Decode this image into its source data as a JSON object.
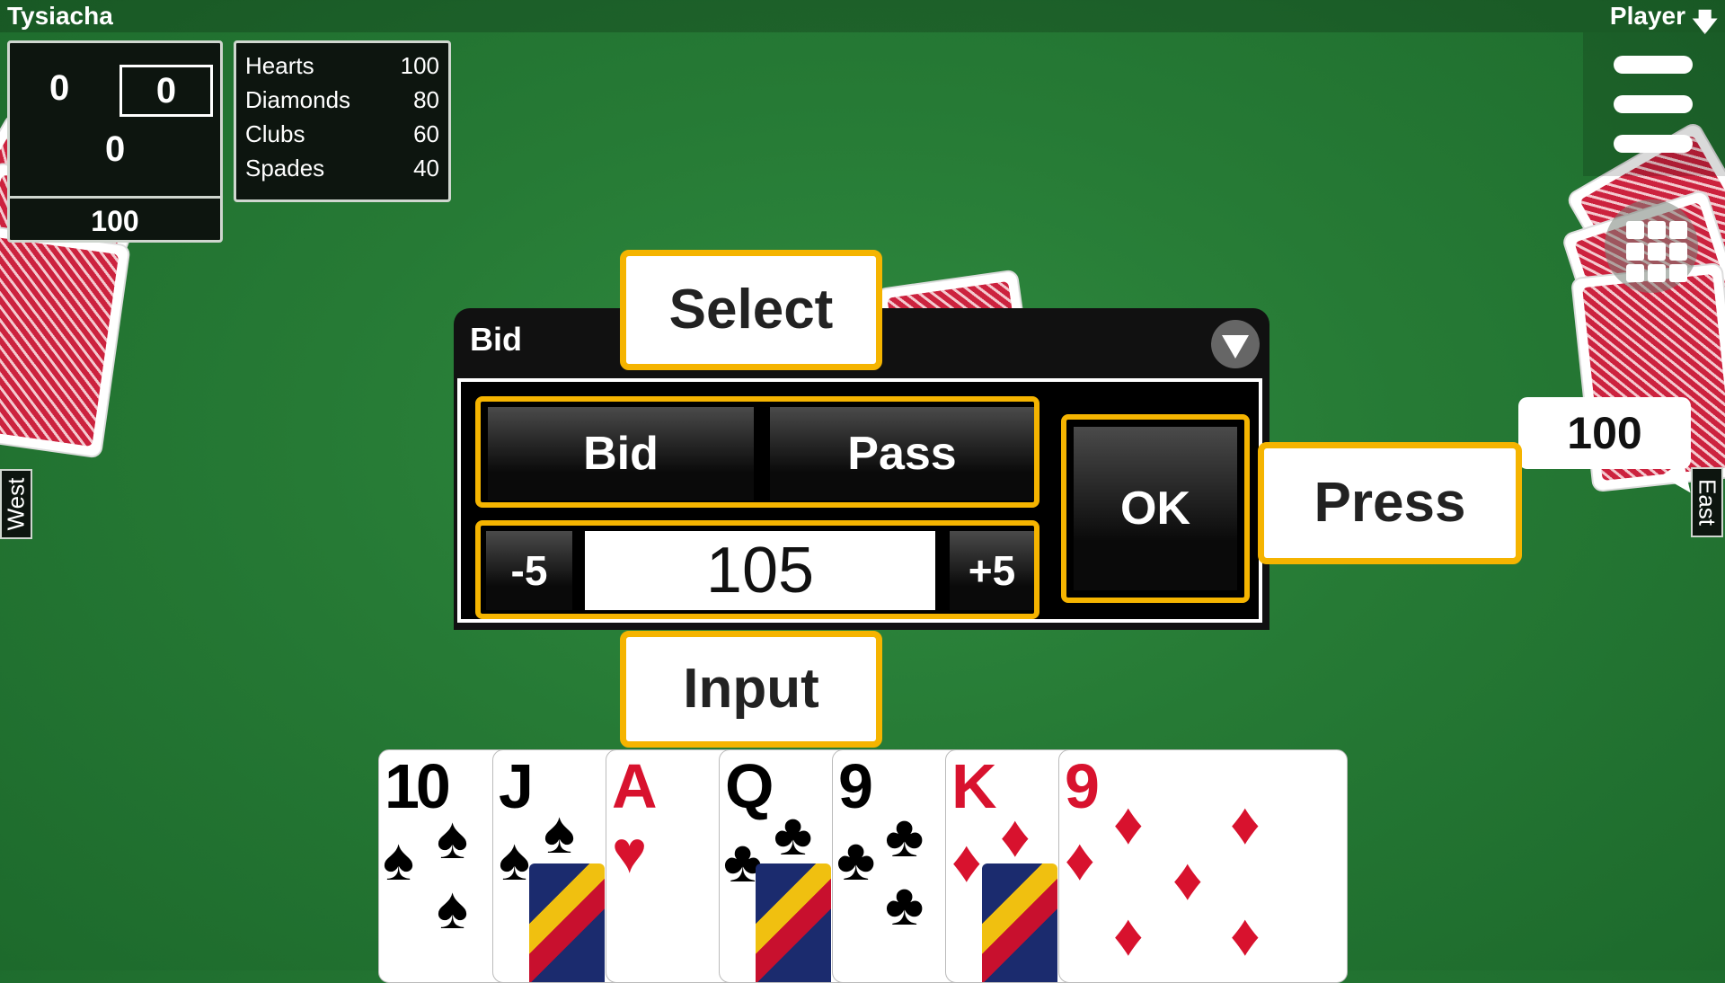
{
  "header": {
    "app_title": "Tysiacha",
    "player_label": "Player",
    "player_arrow": "🡇"
  },
  "scoreboard": {
    "score_a": "0",
    "score_b": "0",
    "score_c": "0",
    "current_bid": "100"
  },
  "suit_values": [
    {
      "suit": "Hearts",
      "value": "100"
    },
    {
      "suit": "Diamonds",
      "value": "80"
    },
    {
      "suit": "Clubs",
      "value": "60"
    },
    {
      "suit": "Spades",
      "value": "40"
    }
  ],
  "seats": {
    "west": "West",
    "east": "East"
  },
  "east_bubble": "100",
  "dialog": {
    "title": "Bid",
    "seg_bid": "Bid",
    "seg_pass": "Pass",
    "minus": "-5",
    "bid_value": "105",
    "plus": "+5",
    "ok": "OK"
  },
  "callouts": {
    "select": "Select",
    "input": "Input",
    "press": "Press"
  },
  "hand": [
    {
      "rank": "10",
      "suit": "♠",
      "color": "black"
    },
    {
      "rank": "J",
      "suit": "♠",
      "color": "black"
    },
    {
      "rank": "A",
      "suit": "♥",
      "color": "red"
    },
    {
      "rank": "Q",
      "suit": "♣",
      "color": "black"
    },
    {
      "rank": "9",
      "suit": "♣",
      "color": "black"
    },
    {
      "rank": "K",
      "suit": "♦",
      "color": "red"
    },
    {
      "rank": "9",
      "suit": "♦",
      "color": "red"
    }
  ],
  "colors": {
    "felt": "#267a35",
    "highlight": "#f5b400",
    "card_red": "#d8122e"
  }
}
